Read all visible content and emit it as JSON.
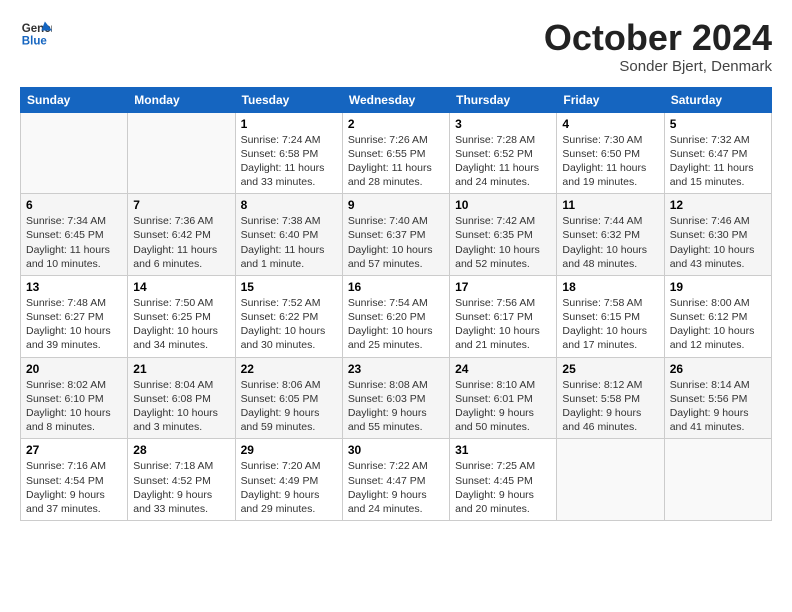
{
  "logo": {
    "line1": "General",
    "line2": "Blue"
  },
  "title": "October 2024",
  "subtitle": "Sonder Bjert, Denmark",
  "weekdays": [
    "Sunday",
    "Monday",
    "Tuesday",
    "Wednesday",
    "Thursday",
    "Friday",
    "Saturday"
  ],
  "weeks": [
    [
      {
        "day": "",
        "info": ""
      },
      {
        "day": "",
        "info": ""
      },
      {
        "day": "1",
        "info": "Sunrise: 7:24 AM\nSunset: 6:58 PM\nDaylight: 11 hours\nand 33 minutes."
      },
      {
        "day": "2",
        "info": "Sunrise: 7:26 AM\nSunset: 6:55 PM\nDaylight: 11 hours\nand 28 minutes."
      },
      {
        "day": "3",
        "info": "Sunrise: 7:28 AM\nSunset: 6:52 PM\nDaylight: 11 hours\nand 24 minutes."
      },
      {
        "day": "4",
        "info": "Sunrise: 7:30 AM\nSunset: 6:50 PM\nDaylight: 11 hours\nand 19 minutes."
      },
      {
        "day": "5",
        "info": "Sunrise: 7:32 AM\nSunset: 6:47 PM\nDaylight: 11 hours\nand 15 minutes."
      }
    ],
    [
      {
        "day": "6",
        "info": "Sunrise: 7:34 AM\nSunset: 6:45 PM\nDaylight: 11 hours\nand 10 minutes."
      },
      {
        "day": "7",
        "info": "Sunrise: 7:36 AM\nSunset: 6:42 PM\nDaylight: 11 hours\nand 6 minutes."
      },
      {
        "day": "8",
        "info": "Sunrise: 7:38 AM\nSunset: 6:40 PM\nDaylight: 11 hours\nand 1 minute."
      },
      {
        "day": "9",
        "info": "Sunrise: 7:40 AM\nSunset: 6:37 PM\nDaylight: 10 hours\nand 57 minutes."
      },
      {
        "day": "10",
        "info": "Sunrise: 7:42 AM\nSunset: 6:35 PM\nDaylight: 10 hours\nand 52 minutes."
      },
      {
        "day": "11",
        "info": "Sunrise: 7:44 AM\nSunset: 6:32 PM\nDaylight: 10 hours\nand 48 minutes."
      },
      {
        "day": "12",
        "info": "Sunrise: 7:46 AM\nSunset: 6:30 PM\nDaylight: 10 hours\nand 43 minutes."
      }
    ],
    [
      {
        "day": "13",
        "info": "Sunrise: 7:48 AM\nSunset: 6:27 PM\nDaylight: 10 hours\nand 39 minutes."
      },
      {
        "day": "14",
        "info": "Sunrise: 7:50 AM\nSunset: 6:25 PM\nDaylight: 10 hours\nand 34 minutes."
      },
      {
        "day": "15",
        "info": "Sunrise: 7:52 AM\nSunset: 6:22 PM\nDaylight: 10 hours\nand 30 minutes."
      },
      {
        "day": "16",
        "info": "Sunrise: 7:54 AM\nSunset: 6:20 PM\nDaylight: 10 hours\nand 25 minutes."
      },
      {
        "day": "17",
        "info": "Sunrise: 7:56 AM\nSunset: 6:17 PM\nDaylight: 10 hours\nand 21 minutes."
      },
      {
        "day": "18",
        "info": "Sunrise: 7:58 AM\nSunset: 6:15 PM\nDaylight: 10 hours\nand 17 minutes."
      },
      {
        "day": "19",
        "info": "Sunrise: 8:00 AM\nSunset: 6:12 PM\nDaylight: 10 hours\nand 12 minutes."
      }
    ],
    [
      {
        "day": "20",
        "info": "Sunrise: 8:02 AM\nSunset: 6:10 PM\nDaylight: 10 hours\nand 8 minutes."
      },
      {
        "day": "21",
        "info": "Sunrise: 8:04 AM\nSunset: 6:08 PM\nDaylight: 10 hours\nand 3 minutes."
      },
      {
        "day": "22",
        "info": "Sunrise: 8:06 AM\nSunset: 6:05 PM\nDaylight: 9 hours\nand 59 minutes."
      },
      {
        "day": "23",
        "info": "Sunrise: 8:08 AM\nSunset: 6:03 PM\nDaylight: 9 hours\nand 55 minutes."
      },
      {
        "day": "24",
        "info": "Sunrise: 8:10 AM\nSunset: 6:01 PM\nDaylight: 9 hours\nand 50 minutes."
      },
      {
        "day": "25",
        "info": "Sunrise: 8:12 AM\nSunset: 5:58 PM\nDaylight: 9 hours\nand 46 minutes."
      },
      {
        "day": "26",
        "info": "Sunrise: 8:14 AM\nSunset: 5:56 PM\nDaylight: 9 hours\nand 41 minutes."
      }
    ],
    [
      {
        "day": "27",
        "info": "Sunrise: 7:16 AM\nSunset: 4:54 PM\nDaylight: 9 hours\nand 37 minutes."
      },
      {
        "day": "28",
        "info": "Sunrise: 7:18 AM\nSunset: 4:52 PM\nDaylight: 9 hours\nand 33 minutes."
      },
      {
        "day": "29",
        "info": "Sunrise: 7:20 AM\nSunset: 4:49 PM\nDaylight: 9 hours\nand 29 minutes."
      },
      {
        "day": "30",
        "info": "Sunrise: 7:22 AM\nSunset: 4:47 PM\nDaylight: 9 hours\nand 24 minutes."
      },
      {
        "day": "31",
        "info": "Sunrise: 7:25 AM\nSunset: 4:45 PM\nDaylight: 9 hours\nand 20 minutes."
      },
      {
        "day": "",
        "info": ""
      },
      {
        "day": "",
        "info": ""
      }
    ]
  ]
}
